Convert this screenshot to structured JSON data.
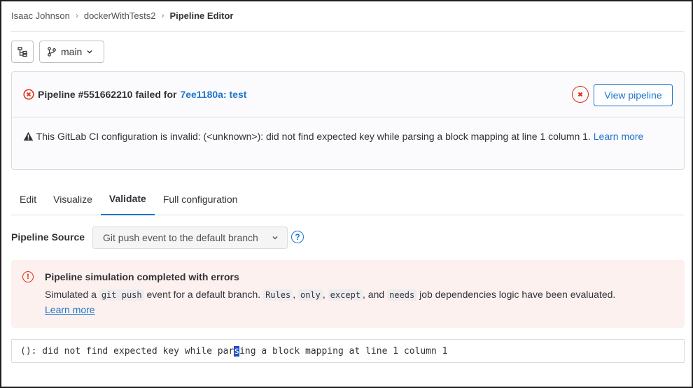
{
  "breadcrumb": {
    "items": [
      "Isaac Johnson",
      "dockerWithTests2",
      "Pipeline Editor"
    ]
  },
  "toolbar": {
    "tree_icon": "file-tree-icon",
    "branch_icon": "branch-icon",
    "branch": "main"
  },
  "pipeline_status": {
    "prefix": "Pipeline #551662210 failed for",
    "commit_link": "7ee1180a: test",
    "view_button": "View pipeline",
    "status_color": "#dd2b0e"
  },
  "validation_warning": {
    "text": "This GitLab CI configuration is invalid: (<unknown>): did not find expected key while parsing a block mapping at line 1 column 1.",
    "learn_more": "Learn more"
  },
  "tabs": [
    "Edit",
    "Visualize",
    "Validate",
    "Full configuration"
  ],
  "active_tab": "Validate",
  "pipeline_source": {
    "label": "Pipeline Source",
    "selected": "Git push event to the default branch"
  },
  "alert": {
    "title": "Pipeline simulation completed with errors",
    "body_1": "Simulated a",
    "code_git_push": "git push",
    "body_2": "event for a default branch.",
    "code_rules": "Rules",
    "sep_comma": ",",
    "code_only": "only",
    "code_except": "except",
    "body_and": ", and",
    "code_needs": "needs",
    "body_3": "job dependencies logic have been evaluated.",
    "learn_more": "Learn more"
  },
  "output": {
    "before_caret": "(): did not find expected key while par",
    "caret_char": "s",
    "after_caret": "ing a block mapping at line 1 column 1"
  }
}
